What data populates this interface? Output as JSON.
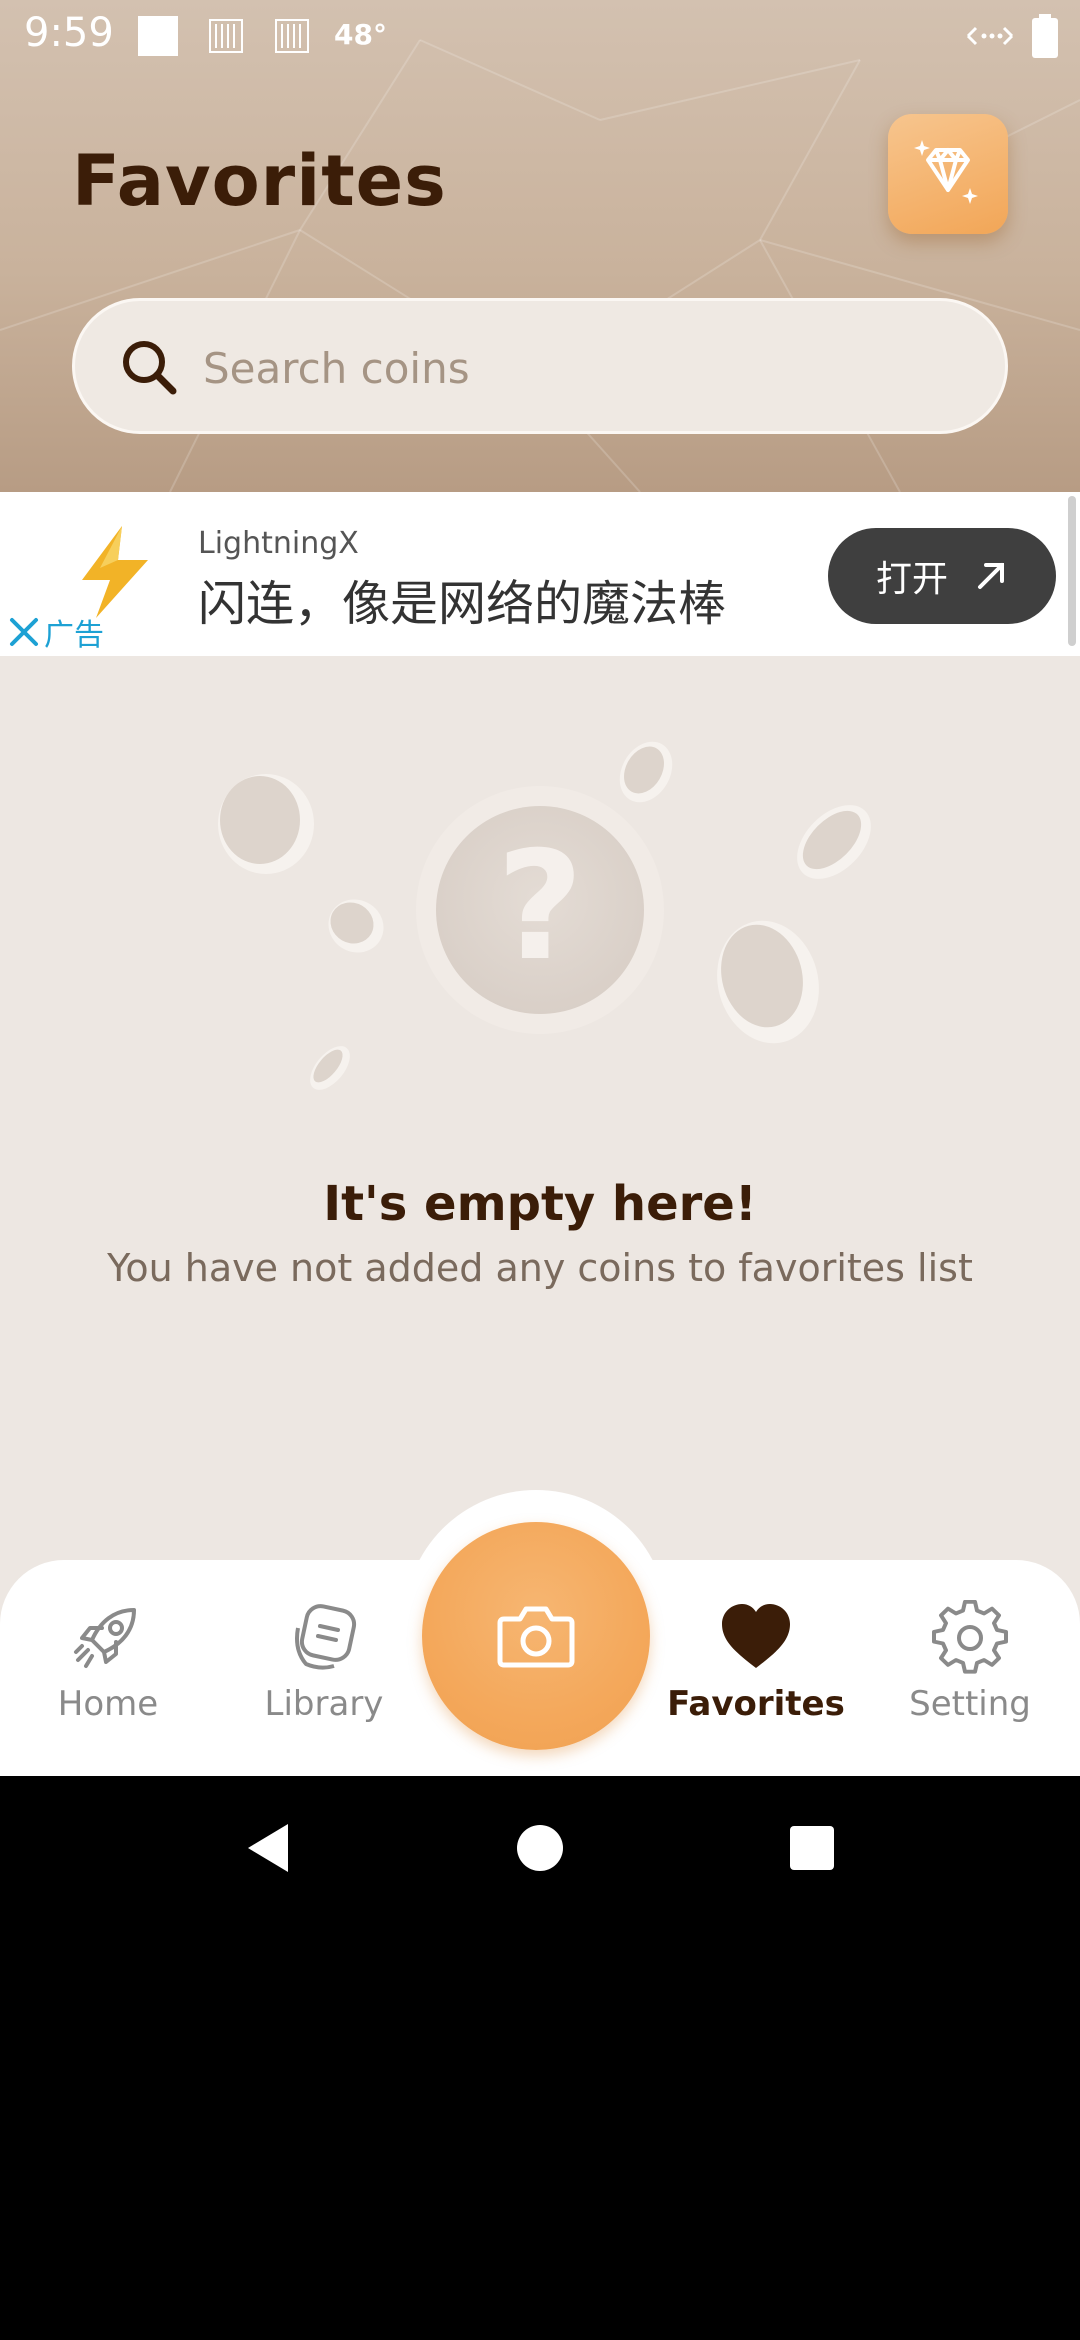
{
  "status_bar": {
    "time": "9:59",
    "temperature": "48°"
  },
  "header": {
    "title": "Favorites",
    "premium_icon": "diamond-icon"
  },
  "search": {
    "placeholder": "Search coins",
    "value": ""
  },
  "ad": {
    "brand": "LightningX",
    "text": "闪连，像是网络的魔法棒",
    "open_label": "打开",
    "close_label": "广告"
  },
  "empty_state": {
    "title": "It's empty here!",
    "subtitle": "You have not added any coins to favorites list"
  },
  "bottom_nav": {
    "items": [
      {
        "label": "Home",
        "icon": "rocket-icon",
        "active": false
      },
      {
        "label": "Library",
        "icon": "library-icon",
        "active": false
      },
      {
        "label": "Favorites",
        "icon": "heart-icon",
        "active": true
      },
      {
        "label": "Setting",
        "icon": "gear-icon",
        "active": false
      }
    ],
    "center_icon": "camera-icon"
  },
  "colors": {
    "accent": "#f4a85b",
    "title": "#3b1d08",
    "background": "#ede7e2"
  }
}
